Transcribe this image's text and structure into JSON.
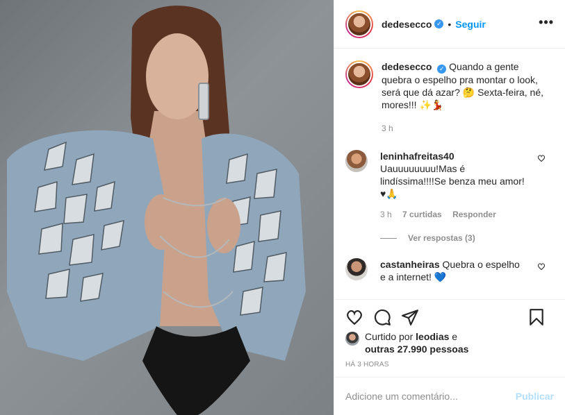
{
  "header": {
    "username": "dedesecco",
    "separator": "•",
    "follow_label": "Seguir",
    "more_label": "•••",
    "verified_icon": "verified-badge-icon"
  },
  "caption": {
    "username": "dedesecco",
    "text": "Quando a gente quebra o espelho pra montar o look, será que dá azar? 🤔 Sexta-feira, né, mores!!! ✨💃",
    "time": "3 h"
  },
  "comments": [
    {
      "username": "leninhafreitas40",
      "text": "Uauuuuuuuu!Mas é lindíssima!!!!Se benza meu amor! ♥🙏",
      "time": "3 h",
      "likes": "7 curtidas",
      "reply_label": "Responder",
      "view_replies": "Ver respostas (3)"
    },
    {
      "username": "castanheiras",
      "text": "Quebra o espelho e a internet! 💙"
    }
  ],
  "likes": {
    "prefix": "Curtido por ",
    "user": "leodias",
    "middle": " e",
    "others": "outras 27.990 pessoas"
  },
  "timestamp": "HÁ 3 HORAS",
  "add_comment": {
    "placeholder": "Adicione um comentário...",
    "publish_label": "Publicar"
  },
  "colors": {
    "accent": "#0095f6",
    "publish_disabled": "#b2dffc",
    "muted": "#8e8e8e",
    "text": "#262626"
  }
}
